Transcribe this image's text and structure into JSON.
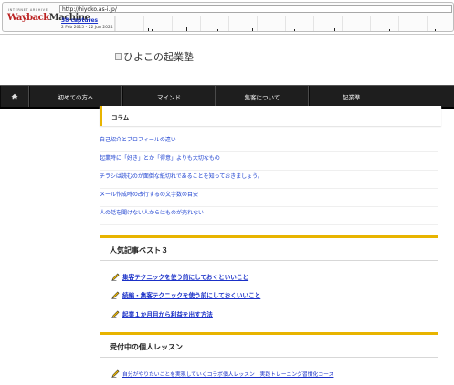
{
  "wayback": {
    "ia_label": "INTERNET ARCHIVE",
    "logo_left": "Wayback",
    "logo_right": "Machine",
    "url": "http://hiyoko.as-i.jp/",
    "captures": "38 captures",
    "date_range": "2 Feb 2015 - 22 Jun 2024"
  },
  "site": {
    "logo_alt": "ひよこの起業塾"
  },
  "nav": {
    "home_icon": "home-icon",
    "items": [
      "初めての方へ",
      "マインド",
      "集客について",
      "起業準"
    ]
  },
  "column": {
    "title": "コラム",
    "links": [
      "自己紹介とプロフィールの違い",
      "起業時に「好き」とか「得意」よりも大切なもの",
      "チラシは読むのが面倒な紙切れであることを知っておきましょう。",
      "メール作成時の改行するの文字数の目安",
      "人の話を聞けない人からはものが売れない"
    ]
  },
  "popular": {
    "title": "人気記事ベスト３",
    "items": [
      "集客テクニックを使う前にしておくといいこと",
      "続編・集客テクニックを使う前にしておくいいこと",
      "起業１か月目から利益を出す方法"
    ]
  },
  "lessons": {
    "title": "受付中の個人レッスン",
    "items": [
      "自分がやりたいことを実現していくコラボ個人レッスン　実践トレーニング習慣化コース"
    ]
  },
  "colors": {
    "accent": "#e8b400",
    "link": "#1a3fd0",
    "nav_bg": "#1e1e1e"
  }
}
